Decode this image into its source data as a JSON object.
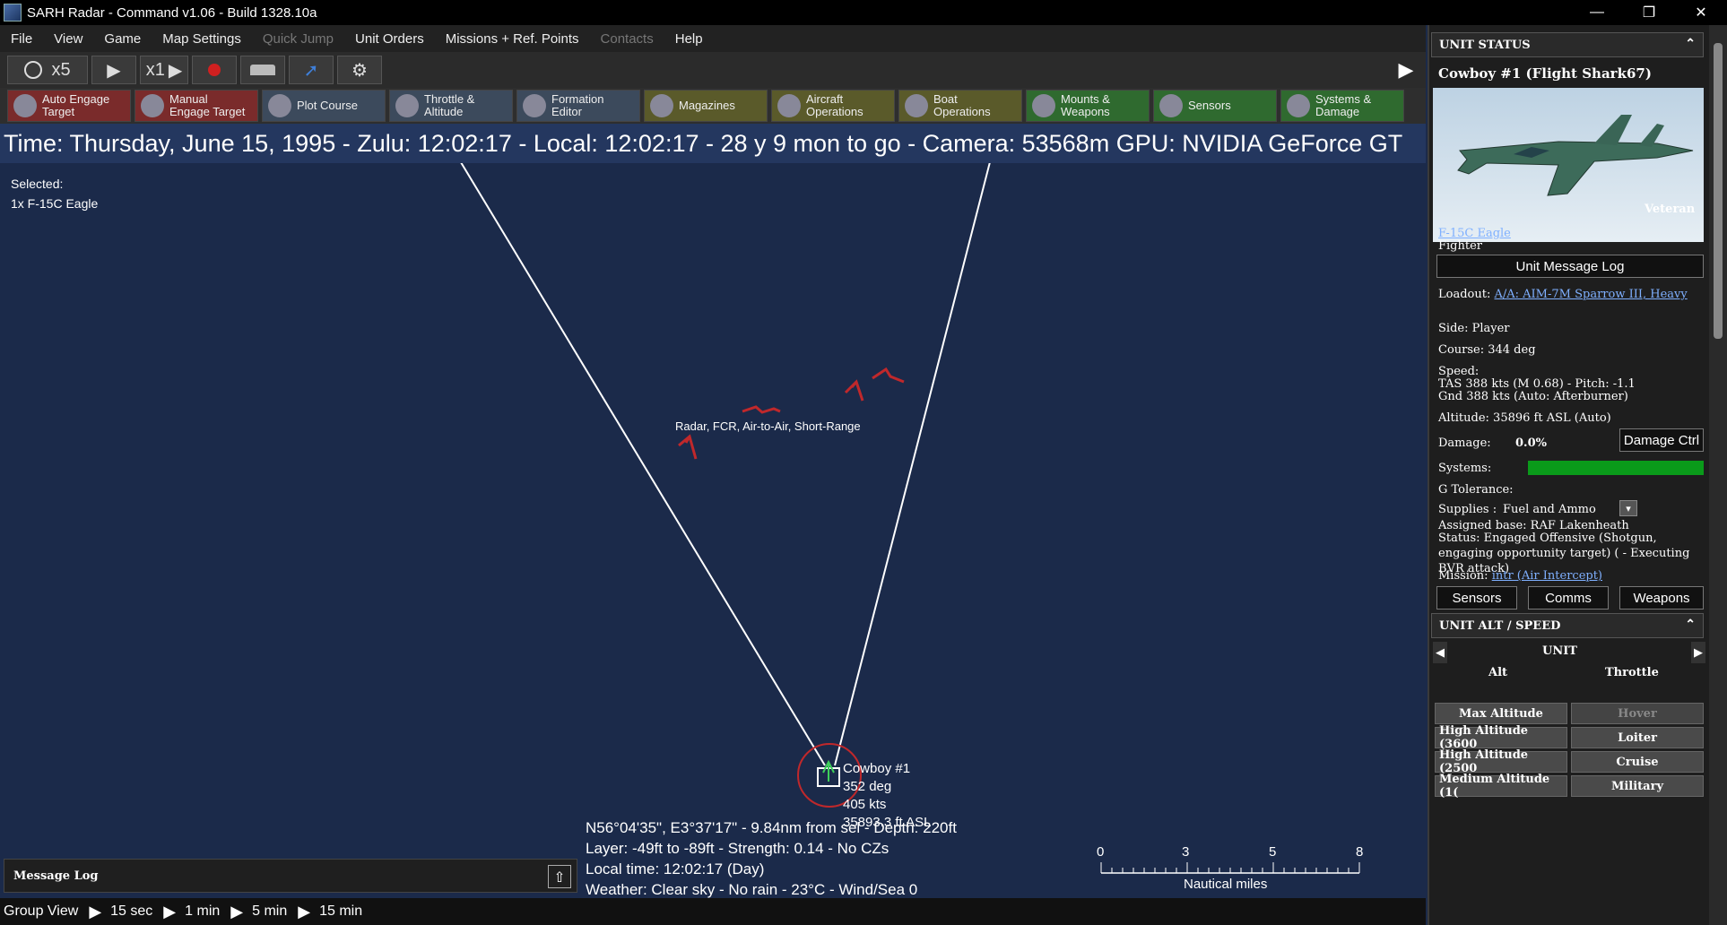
{
  "window": {
    "title": "SARH Radar - Command v1.06 - Build 1328.10a",
    "controls": {
      "minimize": "—",
      "restore": "❐",
      "close": "✕"
    }
  },
  "menu": {
    "items": [
      {
        "label": "File",
        "enabled": true
      },
      {
        "label": "View",
        "enabled": true
      },
      {
        "label": "Game",
        "enabled": true
      },
      {
        "label": "Map Settings",
        "enabled": true
      },
      {
        "label": "Quick Jump",
        "enabled": false
      },
      {
        "label": "Unit Orders",
        "enabled": true
      },
      {
        "label": "Missions + Ref. Points",
        "enabled": true
      },
      {
        "label": "Contacts",
        "enabled": false
      },
      {
        "label": "Help",
        "enabled": true
      }
    ]
  },
  "timebar": {
    "speed_multiplier": "x5",
    "step_multiplier": "x1",
    "icons": [
      "clock-icon",
      "play-icon",
      "step-icon",
      "record-icon",
      "dock-icon",
      "jump-icon",
      "settings-icon"
    ]
  },
  "commands": [
    {
      "label": "Auto Engage\nTarget",
      "color": "red",
      "icon": "auto-engage-icon"
    },
    {
      "label": "Manual\nEngage Target",
      "color": "red",
      "icon": "manual-engage-icon"
    },
    {
      "label": "Plot Course",
      "color": "blue",
      "icon": "plot-course-icon"
    },
    {
      "label": "Throttle &\nAltitude",
      "color": "blue",
      "icon": "throttle-icon"
    },
    {
      "label": "Formation\nEditor",
      "color": "blue",
      "icon": "formation-icon"
    },
    {
      "label": "Magazines",
      "color": "olive",
      "icon": "magazines-icon"
    },
    {
      "label": "Aircraft\nOperations",
      "color": "olive",
      "icon": "aircraft-icon"
    },
    {
      "label": "Boat\nOperations",
      "color": "olive",
      "icon": "boat-icon"
    },
    {
      "label": "Mounts &\nWeapons",
      "color": "green",
      "icon": "mounts-icon"
    },
    {
      "label": "Sensors",
      "color": "green",
      "icon": "sensors-icon"
    },
    {
      "label": "Systems &\nDamage",
      "color": "green",
      "icon": "systems-icon"
    }
  ],
  "timestrip": {
    "text": "Time: Thursday, June 15, 1995 - Zulu: 12:02:17 - Local: 12:02:17 - 28 y 9 mon to go -  Camera: 53568m  GPU: NVIDIA GeForce GT"
  },
  "map": {
    "selected_label": "Selected:",
    "selected_unit": "1x F-15C Eagle",
    "radar_label": "Radar, FCR, Air-to-Air, Short-Range",
    "unit": {
      "name": "Cowboy #1",
      "heading": "352 deg",
      "speed": "405 kts",
      "altitude": "35893.3 ft ASL"
    },
    "info_lines": [
      "N56°04'35\", E3°37'17\" - 9.84nm from sel - Depth: 220ft",
      "Layer: -49ft to -89ft - Strength: 0.14 - No CZs",
      "Local time: 12:02:17 (Day)",
      "Weather: Clear sky - No rain - 23°C - Wind/Sea 0"
    ],
    "scale": {
      "ticks": [
        "0",
        "3",
        "5",
        "8"
      ],
      "unit": "Nautical miles"
    },
    "colors": {
      "background": "#1b2a4a",
      "contact": "#c0282b",
      "radar_line": "#ffffff",
      "unit": "#3ecf5a"
    }
  },
  "message_log": {
    "title": "Message Log"
  },
  "group_view": {
    "label": "Group View",
    "options": [
      "15 sec",
      "1 min",
      "5 min",
      "15 min"
    ]
  },
  "unit_status": {
    "header": "UNIT STATUS",
    "unit_title": "Cowboy #1 (Flight Shark67)",
    "proficiency": "Veteran",
    "class_link": "F-15C Eagle",
    "role": "Fighter",
    "message_log_button": "Unit Message Log",
    "loadout_label": "Loadout:",
    "loadout_value": "A/A: AIM-7M Sparrow III, Heavy",
    "side": "Side: Player",
    "course": "Course: 344 deg",
    "speed_label": "Speed:",
    "speed_tas": "TAS 388 kts (M 0.68) - Pitch: -1.1",
    "speed_gnd": "Gnd 388 kts (Auto: Afterburner)",
    "altitude": "Altitude: 35896 ft ASL (Auto)",
    "damage_label": "Damage:",
    "damage_value": "0.0%",
    "damage_button": "Damage Ctrl",
    "systems_label": "Systems:",
    "systems_health": 1.0,
    "systems_color": "#0a9a1a",
    "gtol_label": "G Tolerance:",
    "supplies_label": "Supplies :",
    "supplies_value": "Fuel and Ammo",
    "assigned_base": "Assigned base: RAF Lakenheath",
    "status": "Status: Engaged Offensive (Shotgun, engaging opportunity target) ( - Executing BVR attack)",
    "mission_label": "Mission:",
    "mission_value": "intr (Air Intercept)",
    "tab_buttons": [
      "Sensors",
      "Comms",
      "Weapons"
    ]
  },
  "alt_speed": {
    "header": "UNIT ALT / SPEED",
    "mode": "UNIT",
    "col_alt": "Alt",
    "col_throttle": "Throttle",
    "alt_buttons": [
      "Max Altitude",
      "High Altitude (3600",
      "High Altitude (2500",
      "Medium Altitude (1("
    ],
    "throttle_buttons": [
      "Hover",
      "Loiter",
      "Cruise",
      "Military"
    ]
  }
}
